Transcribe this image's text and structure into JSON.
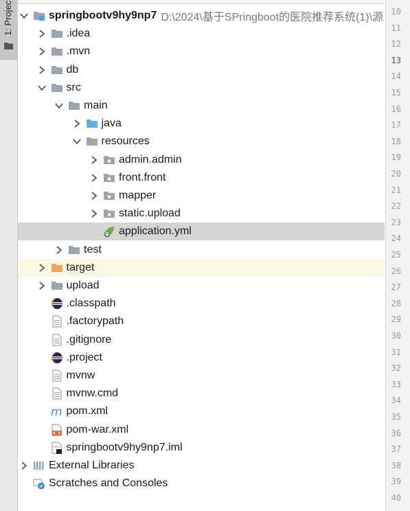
{
  "sidebar": {
    "tab_label": "1: Project",
    "icon": "folder-icon"
  },
  "tree": {
    "rows": [
      {
        "name": "springbootv9hy9np7",
        "path": "D:\\2024\\基于SPringboot的医院推荐系统(1)\\源",
        "bold": true,
        "level": 0,
        "arrow": "down",
        "icon": "module-folder-icon"
      },
      {
        "name": ".idea",
        "level": 1,
        "arrow": "right",
        "icon": "folder-icon"
      },
      {
        "name": ".mvn",
        "level": 1,
        "arrow": "right",
        "icon": "folder-icon"
      },
      {
        "name": "db",
        "level": 1,
        "arrow": "right",
        "icon": "folder-icon"
      },
      {
        "name": "src",
        "level": 1,
        "arrow": "down",
        "icon": "folder-icon"
      },
      {
        "name": "main",
        "level": 2,
        "arrow": "down",
        "icon": "folder-icon"
      },
      {
        "name": "java",
        "level": 3,
        "arrow": "right",
        "icon": "source-folder-icon"
      },
      {
        "name": "resources",
        "level": 3,
        "arrow": "down",
        "icon": "resources-folder-icon"
      },
      {
        "name": "admin.admin",
        "level": 4,
        "arrow": "right",
        "icon": "package-folder-icon"
      },
      {
        "name": "front.front",
        "level": 4,
        "arrow": "right",
        "icon": "package-folder-icon"
      },
      {
        "name": "mapper",
        "level": 4,
        "arrow": "right",
        "icon": "package-folder-icon"
      },
      {
        "name": "static.upload",
        "level": 4,
        "arrow": "right",
        "icon": "package-folder-icon"
      },
      {
        "name": "application.yml",
        "level": 4,
        "arrow": "none",
        "icon": "spring-config-icon",
        "selected": true
      },
      {
        "name": "test",
        "level": 2,
        "arrow": "right",
        "icon": "folder-icon"
      },
      {
        "name": "target",
        "level": 1,
        "arrow": "right",
        "icon": "excluded-folder-icon",
        "highlight": true
      },
      {
        "name": "upload",
        "level": 1,
        "arrow": "right",
        "icon": "folder-icon"
      },
      {
        "name": ".classpath",
        "level": 1,
        "arrow": "none",
        "icon": "eclipse-icon"
      },
      {
        "name": ".factorypath",
        "level": 1,
        "arrow": "none",
        "icon": "text-file-icon"
      },
      {
        "name": ".gitignore",
        "level": 1,
        "arrow": "none",
        "icon": "text-file-icon"
      },
      {
        "name": ".project",
        "level": 1,
        "arrow": "none",
        "icon": "eclipse-icon"
      },
      {
        "name": "mvnw",
        "level": 1,
        "arrow": "none",
        "icon": "text-file-icon"
      },
      {
        "name": "mvnw.cmd",
        "level": 1,
        "arrow": "none",
        "icon": "text-file-icon"
      },
      {
        "name": "pom.xml",
        "level": 1,
        "arrow": "none",
        "icon": "maven-icon"
      },
      {
        "name": "pom-war.xml",
        "level": 1,
        "arrow": "none",
        "icon": "xml-file-icon"
      },
      {
        "name": "springbootv9hy9np7.iml",
        "level": 1,
        "arrow": "none",
        "icon": "iml-file-icon"
      },
      {
        "name": "External Libraries",
        "level": 0,
        "arrow": "right",
        "icon": "libraries-icon"
      },
      {
        "name": "Scratches and Consoles",
        "level": 0,
        "arrow": "none",
        "icon": "scratches-icon"
      }
    ]
  },
  "gutter": {
    "line_numbers": [
      "10",
      "11",
      "12",
      "13",
      "14",
      "15",
      "16",
      "17",
      "18",
      "19",
      "20",
      "21",
      "22",
      "23",
      "24",
      "25",
      "26",
      "27",
      "28",
      "29",
      "30",
      "31",
      "32",
      "33",
      "34",
      "35",
      "36",
      "37",
      "38",
      "39",
      "40"
    ],
    "current_line": "13"
  },
  "colors": {
    "selected_row": "#d5d5d5",
    "highlight_row": "#fbf8e3",
    "folder": "#9aa7b0",
    "source_folder": "#62b0de",
    "excluded_folder": "#f2a35e"
  }
}
